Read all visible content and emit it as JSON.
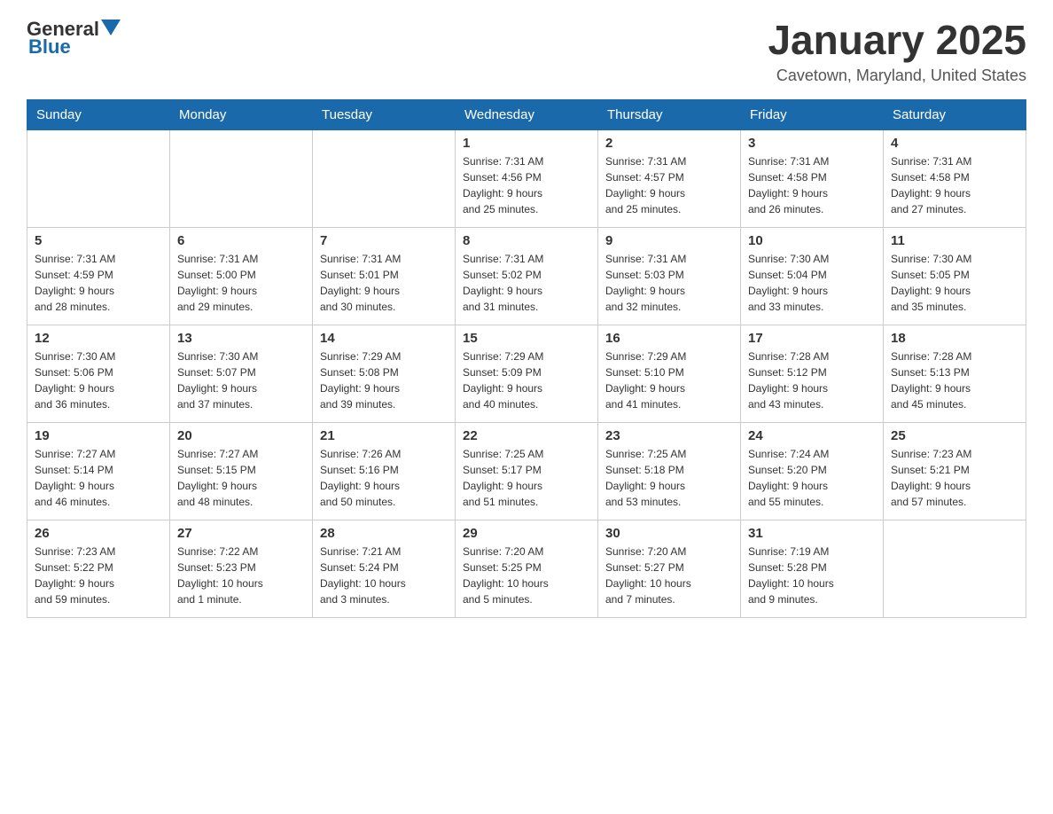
{
  "logo": {
    "text_general": "General",
    "text_blue": "Blue"
  },
  "header": {
    "title": "January 2025",
    "subtitle": "Cavetown, Maryland, United States"
  },
  "days_of_week": [
    "Sunday",
    "Monday",
    "Tuesday",
    "Wednesday",
    "Thursday",
    "Friday",
    "Saturday"
  ],
  "weeks": [
    [
      {
        "num": "",
        "info": ""
      },
      {
        "num": "",
        "info": ""
      },
      {
        "num": "",
        "info": ""
      },
      {
        "num": "1",
        "info": "Sunrise: 7:31 AM\nSunset: 4:56 PM\nDaylight: 9 hours\nand 25 minutes."
      },
      {
        "num": "2",
        "info": "Sunrise: 7:31 AM\nSunset: 4:57 PM\nDaylight: 9 hours\nand 25 minutes."
      },
      {
        "num": "3",
        "info": "Sunrise: 7:31 AM\nSunset: 4:58 PM\nDaylight: 9 hours\nand 26 minutes."
      },
      {
        "num": "4",
        "info": "Sunrise: 7:31 AM\nSunset: 4:58 PM\nDaylight: 9 hours\nand 27 minutes."
      }
    ],
    [
      {
        "num": "5",
        "info": "Sunrise: 7:31 AM\nSunset: 4:59 PM\nDaylight: 9 hours\nand 28 minutes."
      },
      {
        "num": "6",
        "info": "Sunrise: 7:31 AM\nSunset: 5:00 PM\nDaylight: 9 hours\nand 29 minutes."
      },
      {
        "num": "7",
        "info": "Sunrise: 7:31 AM\nSunset: 5:01 PM\nDaylight: 9 hours\nand 30 minutes."
      },
      {
        "num": "8",
        "info": "Sunrise: 7:31 AM\nSunset: 5:02 PM\nDaylight: 9 hours\nand 31 minutes."
      },
      {
        "num": "9",
        "info": "Sunrise: 7:31 AM\nSunset: 5:03 PM\nDaylight: 9 hours\nand 32 minutes."
      },
      {
        "num": "10",
        "info": "Sunrise: 7:30 AM\nSunset: 5:04 PM\nDaylight: 9 hours\nand 33 minutes."
      },
      {
        "num": "11",
        "info": "Sunrise: 7:30 AM\nSunset: 5:05 PM\nDaylight: 9 hours\nand 35 minutes."
      }
    ],
    [
      {
        "num": "12",
        "info": "Sunrise: 7:30 AM\nSunset: 5:06 PM\nDaylight: 9 hours\nand 36 minutes."
      },
      {
        "num": "13",
        "info": "Sunrise: 7:30 AM\nSunset: 5:07 PM\nDaylight: 9 hours\nand 37 minutes."
      },
      {
        "num": "14",
        "info": "Sunrise: 7:29 AM\nSunset: 5:08 PM\nDaylight: 9 hours\nand 39 minutes."
      },
      {
        "num": "15",
        "info": "Sunrise: 7:29 AM\nSunset: 5:09 PM\nDaylight: 9 hours\nand 40 minutes."
      },
      {
        "num": "16",
        "info": "Sunrise: 7:29 AM\nSunset: 5:10 PM\nDaylight: 9 hours\nand 41 minutes."
      },
      {
        "num": "17",
        "info": "Sunrise: 7:28 AM\nSunset: 5:12 PM\nDaylight: 9 hours\nand 43 minutes."
      },
      {
        "num": "18",
        "info": "Sunrise: 7:28 AM\nSunset: 5:13 PM\nDaylight: 9 hours\nand 45 minutes."
      }
    ],
    [
      {
        "num": "19",
        "info": "Sunrise: 7:27 AM\nSunset: 5:14 PM\nDaylight: 9 hours\nand 46 minutes."
      },
      {
        "num": "20",
        "info": "Sunrise: 7:27 AM\nSunset: 5:15 PM\nDaylight: 9 hours\nand 48 minutes."
      },
      {
        "num": "21",
        "info": "Sunrise: 7:26 AM\nSunset: 5:16 PM\nDaylight: 9 hours\nand 50 minutes."
      },
      {
        "num": "22",
        "info": "Sunrise: 7:25 AM\nSunset: 5:17 PM\nDaylight: 9 hours\nand 51 minutes."
      },
      {
        "num": "23",
        "info": "Sunrise: 7:25 AM\nSunset: 5:18 PM\nDaylight: 9 hours\nand 53 minutes."
      },
      {
        "num": "24",
        "info": "Sunrise: 7:24 AM\nSunset: 5:20 PM\nDaylight: 9 hours\nand 55 minutes."
      },
      {
        "num": "25",
        "info": "Sunrise: 7:23 AM\nSunset: 5:21 PM\nDaylight: 9 hours\nand 57 minutes."
      }
    ],
    [
      {
        "num": "26",
        "info": "Sunrise: 7:23 AM\nSunset: 5:22 PM\nDaylight: 9 hours\nand 59 minutes."
      },
      {
        "num": "27",
        "info": "Sunrise: 7:22 AM\nSunset: 5:23 PM\nDaylight: 10 hours\nand 1 minute."
      },
      {
        "num": "28",
        "info": "Sunrise: 7:21 AM\nSunset: 5:24 PM\nDaylight: 10 hours\nand 3 minutes."
      },
      {
        "num": "29",
        "info": "Sunrise: 7:20 AM\nSunset: 5:25 PM\nDaylight: 10 hours\nand 5 minutes."
      },
      {
        "num": "30",
        "info": "Sunrise: 7:20 AM\nSunset: 5:27 PM\nDaylight: 10 hours\nand 7 minutes."
      },
      {
        "num": "31",
        "info": "Sunrise: 7:19 AM\nSunset: 5:28 PM\nDaylight: 10 hours\nand 9 minutes."
      },
      {
        "num": "",
        "info": ""
      }
    ]
  ]
}
